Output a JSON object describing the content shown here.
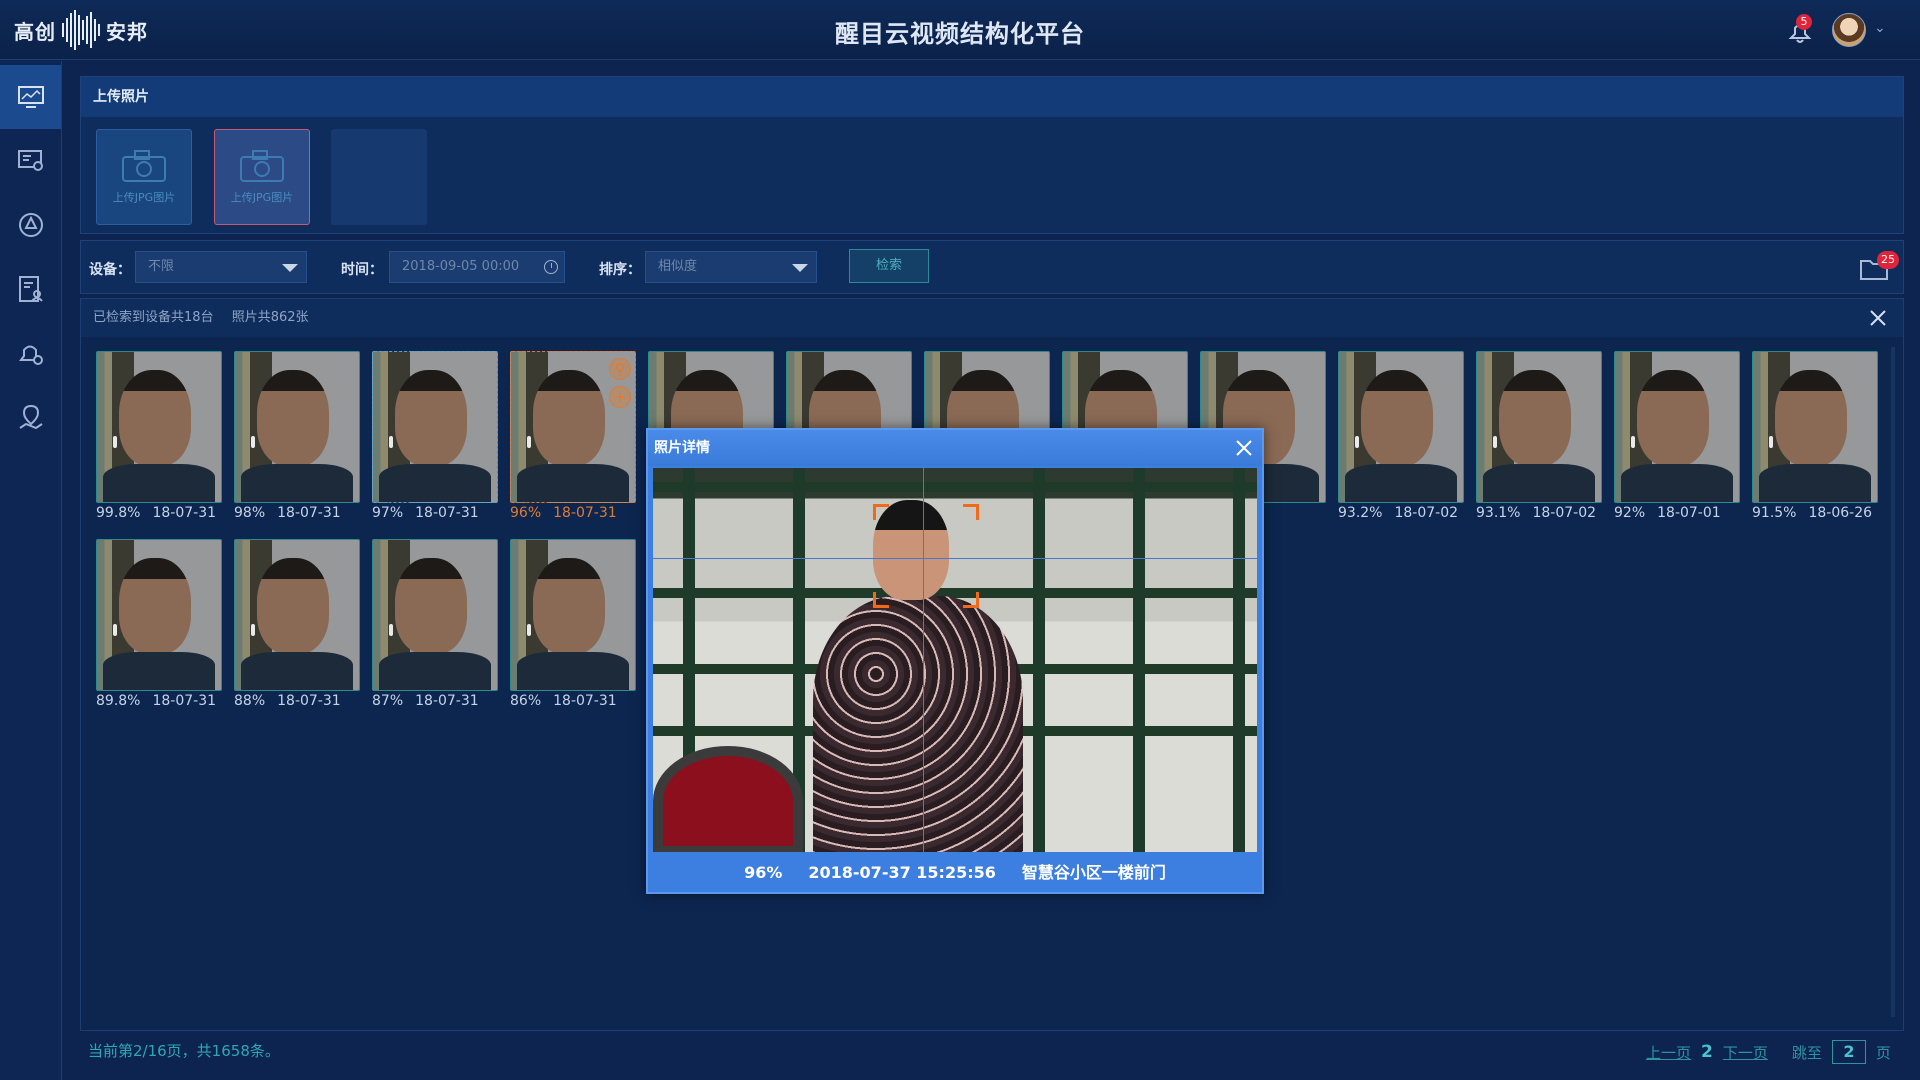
{
  "header": {
    "logo_left": "高创",
    "logo_right": "安邦",
    "title": "醒目云视频结构化平台",
    "notification_count": "5"
  },
  "sidebar": {
    "items": [
      {
        "icon": "monitor-icon",
        "active": true
      },
      {
        "icon": "device-settings-icon",
        "active": false
      },
      {
        "icon": "target-icon",
        "active": false
      },
      {
        "icon": "person-report-icon",
        "active": false
      },
      {
        "icon": "alarm-icon",
        "active": false
      },
      {
        "icon": "location-icon",
        "active": false
      }
    ]
  },
  "upload": {
    "title": "上传照片",
    "slots": [
      {
        "label": "上传JPG图片"
      },
      {
        "label": "上传JPG图片"
      }
    ]
  },
  "filters": {
    "device_label": "设备：",
    "device_value": "不限",
    "time_label": "时间：",
    "time_value": "2018-09-05  00:00",
    "sort_label": "排序：",
    "sort_value": "相似度",
    "search_button": "检索",
    "folder_count": "25"
  },
  "results": {
    "summary_devices": "已检索到设备共18台",
    "summary_photos": "照片共862张",
    "cards": [
      {
        "score": "99.8%",
        "date": "18-07-31"
      },
      {
        "score": "98%",
        "date": "18-07-31"
      },
      {
        "score": "97%",
        "date": "18-07-31"
      },
      {
        "score": "96%",
        "date": "18-07-31"
      },
      {
        "score": "",
        "date": ""
      },
      {
        "score": "",
        "date": ""
      },
      {
        "score": "",
        "date": ""
      },
      {
        "score": "",
        "date": ""
      },
      {
        "score": "",
        "date": "07-03"
      },
      {
        "score": "93.2%",
        "date": "18-07-02"
      },
      {
        "score": "93.1%",
        "date": "18-07-02"
      },
      {
        "score": "92%",
        "date": "18-07-01"
      },
      {
        "score": "91.5%",
        "date": "18-06-26"
      },
      {
        "score": "89.8%",
        "date": "18-07-31"
      },
      {
        "score": "88%",
        "date": "18-07-31"
      },
      {
        "score": "87%",
        "date": "18-07-31"
      },
      {
        "score": "86%",
        "date": "18-07-31"
      }
    ]
  },
  "modal": {
    "title": "照片详情",
    "score": "96%",
    "datetime": "2018-07-37 15:25:56",
    "location": "智慧谷小区一楼前门"
  },
  "footer": {
    "status": "当前第2/16页，共1658条。",
    "prev": "上一页",
    "current": "2",
    "next": "下一页",
    "jump_label": "跳至",
    "jump_value": "2",
    "page_unit": "页"
  },
  "colors": {
    "accent_teal": "#2fa8b3",
    "selected_orange": "#e27a2e",
    "modal_blue": "#3d7fe0",
    "badge_red": "#e0243a"
  }
}
